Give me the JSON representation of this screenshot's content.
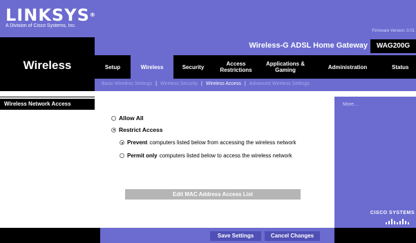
{
  "brand": {
    "logo": "LINKSYS",
    "registered": "®",
    "subtitle": "A Division of Cisco Systems, Inc.",
    "firmware": "Firmware Version: 0.01",
    "product_name": "Wireless-G ADSL Home Gateway",
    "model": "WAG200G"
  },
  "section": {
    "title": "Wireless"
  },
  "tabs": [
    {
      "label": "Setup"
    },
    {
      "label": "Wireless"
    },
    {
      "label": "Security"
    },
    {
      "label": "Access Restrictions"
    },
    {
      "label": "Applications & Gaming"
    },
    {
      "label": "Administration"
    },
    {
      "label": "Status"
    }
  ],
  "subtabs": [
    {
      "label": "Basic Wireless Settings"
    },
    {
      "label": "Wireless Security"
    },
    {
      "label": "Wireless Access"
    },
    {
      "label": "Advanced Wireless Settings"
    }
  ],
  "sidebar": {
    "section_label": "Wireless Network Access"
  },
  "options": {
    "allow_all": "Allow All",
    "restrict_access": "Restrict Access",
    "prevent_bold": "Prevent",
    "prevent_rest": "computers listed below from accessing the wireless network",
    "permit_bold": "Permit only",
    "permit_rest": "computers listed below to access the wireless network"
  },
  "buttons": {
    "edit_mac": "Edit MAC Address Access List",
    "save": "Save Settings",
    "cancel": "Cancel Changes"
  },
  "help": {
    "more": "More..."
  },
  "footer": {
    "cisco": "CISCO SYSTEMS"
  },
  "colors": {
    "brand_blue": "#6b6bd0",
    "black": "#000000",
    "button_gray": "#b5b5b5"
  }
}
